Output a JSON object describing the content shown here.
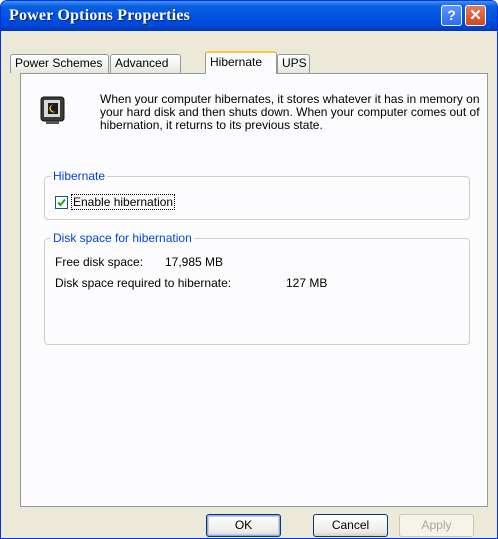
{
  "window": {
    "title": "Power Options Properties"
  },
  "titlebar": {
    "help_glyph": "?",
    "close_glyph": "✕"
  },
  "tabs": [
    {
      "label": "Power Schemes"
    },
    {
      "label": "Advanced"
    },
    {
      "label": "Hibernate",
      "active": true
    },
    {
      "label": "UPS"
    }
  ],
  "hibernate_page": {
    "icon": "monitor-sleep-icon",
    "description": "When your computer hibernates, it stores whatever it has in memory on your hard disk and then shuts down. When your computer comes out of hibernation, it returns to its previous state.",
    "hibernate_group": {
      "legend": "Hibernate",
      "enable_label": "Enable hibernation",
      "enable_checked": true
    },
    "disk_group": {
      "legend": "Disk space for hibernation",
      "free_label": "Free disk space:",
      "free_value": "17,985 MB",
      "required_label": "Disk space required to hibernate:",
      "required_value": "127 MB"
    }
  },
  "buttons": {
    "ok": "OK",
    "cancel": "Cancel",
    "apply": "Apply"
  },
  "colors": {
    "titlebar": "#0054e3",
    "group_legend": "#0046d5",
    "active_tab_highlight": "#ffc73c"
  }
}
